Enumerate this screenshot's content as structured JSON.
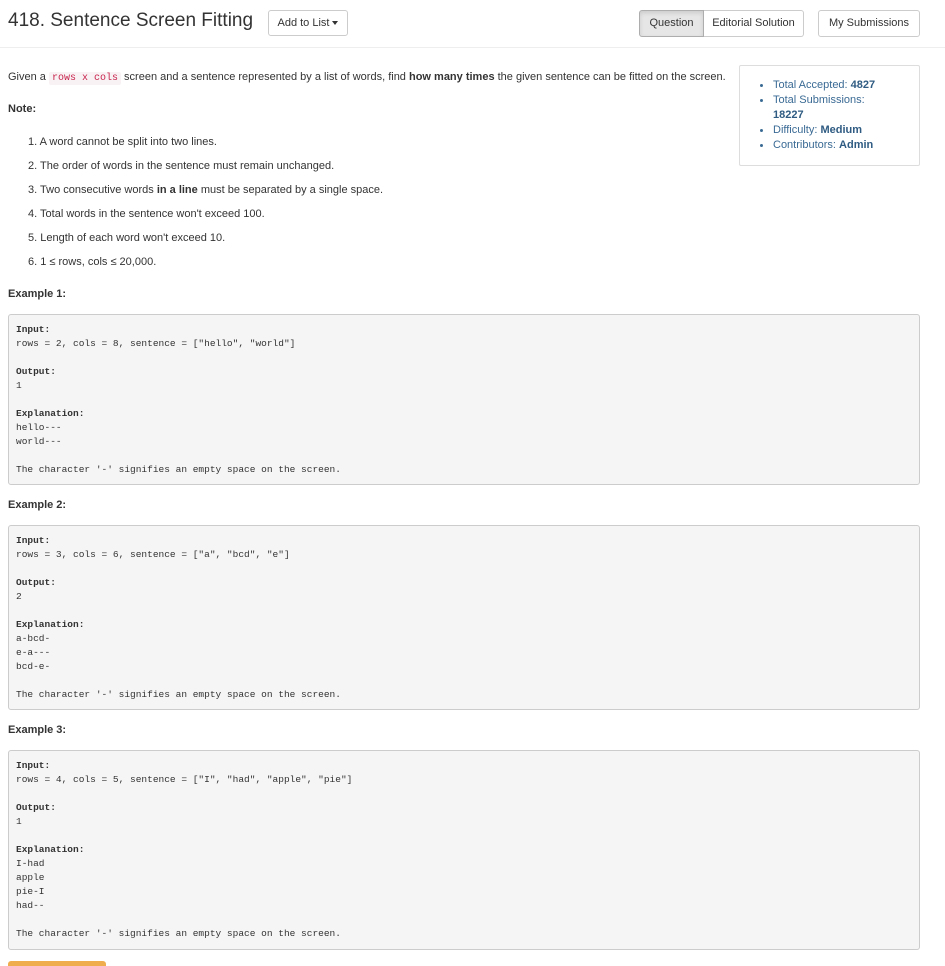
{
  "header": {
    "title": "418. Sentence Screen Fitting",
    "add_to_list": "Add to List",
    "tabs": [
      "Question",
      "Editorial Solution"
    ],
    "active_tab": "Question",
    "my_submissions": "My Submissions"
  },
  "stats": {
    "accepted_label": "Total Accepted:",
    "accepted_value": "4827",
    "submissions_label": "Total Submissions:",
    "submissions_value": "18227",
    "difficulty_label": "Difficulty:",
    "difficulty_value": "Medium",
    "contributors_label": "Contributors:",
    "contributors_value": "Admin"
  },
  "description": {
    "pre": "Given a ",
    "code": "rows x cols",
    "mid": " screen and a sentence represented by a list of words, find ",
    "bold": "how many times",
    "post": " the given sentence can be fitted on the screen."
  },
  "note_label": "Note:",
  "notes": [
    "1. A word cannot be split into two lines.",
    "2. The order of words in the sentence must remain unchanged.",
    {
      "pre": "3. Two consecutive words ",
      "bold": "in a line",
      "post": " must be separated by a single space."
    },
    "4. Total words in the sentence won't exceed 100.",
    "5. Length of each word won't exceed 10.",
    "6. 1 ≤ rows, cols ≤ 20,000."
  ],
  "examples": [
    {
      "heading": "Example 1:",
      "input_label": "Input:",
      "input": "rows = 2, cols = 8, sentence = [\"hello\", \"world\"]",
      "output_label": "Output:",
      "output": "1",
      "explanation_label": "Explanation:",
      "screen": [
        "hello---",
        "world---"
      ],
      "note": "The character '-' signifies an empty space on the screen."
    },
    {
      "heading": "Example 2:",
      "input_label": "Input:",
      "input": "rows = 3, cols = 6, sentence = [\"a\", \"bcd\", \"e\"]",
      "output_label": "Output:",
      "output": "2",
      "explanation_label": "Explanation:",
      "screen": [
        "a-bcd-",
        "e-a---",
        "bcd-e-"
      ],
      "note": "The character '-' signifies an empty space on the screen."
    },
    {
      "heading": "Example 3:",
      "input_label": "Input:",
      "input": "rows = 4, cols = 5, sentence = [\"I\", \"had\", \"apple\", \"pie\"]",
      "output_label": "Output:",
      "output": "1",
      "explanation_label": "Explanation:",
      "screen": [
        "I-had",
        "apple",
        "pie-I",
        "had--"
      ],
      "note": "The character '-' signifies an empty space on the screen."
    }
  ]
}
